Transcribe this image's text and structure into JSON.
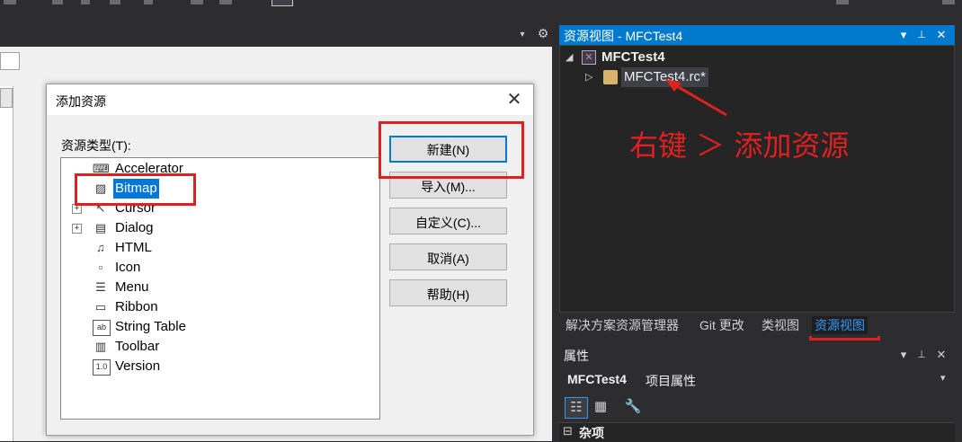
{
  "editor": {
    "dropdown_glyph": "▾",
    "gear_glyph": "⚙"
  },
  "dialog": {
    "title": "添加资源",
    "close_glyph": "✕",
    "resource_type_label": "资源类型(T):",
    "resource_types": [
      {
        "label": "Accelerator",
        "icon": "accelerator-icon",
        "glyph": "⌨",
        "expandable": false,
        "selected": false
      },
      {
        "label": "Bitmap",
        "icon": "bitmap-icon",
        "glyph": "▨",
        "expandable": false,
        "selected": true
      },
      {
        "label": "Cursor",
        "icon": "cursor-icon",
        "glyph": "↖",
        "expandable": true,
        "selected": false
      },
      {
        "label": "Dialog",
        "icon": "dialog-icon",
        "glyph": "▤",
        "expandable": true,
        "selected": false
      },
      {
        "label": "HTML",
        "icon": "html-icon",
        "glyph": "♫",
        "expandable": false,
        "selected": false
      },
      {
        "label": "Icon",
        "icon": "icon-resource-icon",
        "glyph": "▫",
        "expandable": false,
        "selected": false
      },
      {
        "label": "Menu",
        "icon": "menu-icon",
        "glyph": "☰",
        "expandable": false,
        "selected": false
      },
      {
        "label": "Ribbon",
        "icon": "ribbon-icon",
        "glyph": "▭",
        "expandable": false,
        "selected": false
      },
      {
        "label": "String Table",
        "icon": "string-table-icon",
        "glyph": "ab",
        "expandable": false,
        "selected": false
      },
      {
        "label": "Toolbar",
        "icon": "toolbar-icon",
        "glyph": "▥",
        "expandable": false,
        "selected": false
      },
      {
        "label": "Version",
        "icon": "version-icon",
        "glyph": "1.0",
        "expandable": false,
        "selected": false
      }
    ],
    "expander_glyph": "+",
    "buttons": {
      "new": "新建(N)",
      "import": "导入(M)...",
      "custom": "自定义(C)...",
      "cancel": "取消(A)",
      "help": "帮助(H)"
    }
  },
  "resource_view": {
    "title": "资源视图 - MFCTest4",
    "title_dropdown": "▾",
    "title_pin": "📌",
    "title_close": "✕",
    "project_name": "MFCTest4",
    "rc_file": "MFCTest4.rc*",
    "project_arrow": "◢",
    "rc_arrow": "▷"
  },
  "annotation": {
    "text": "右键 ＞ 添加资源",
    "color": "#e02020"
  },
  "tabs": [
    {
      "label": "解决方案资源管理器",
      "active": false
    },
    {
      "label": "Git 更改",
      "active": false
    },
    {
      "label": "类视图",
      "active": false
    },
    {
      "label": "资源视图",
      "active": true
    }
  ],
  "properties": {
    "title": "属性",
    "object_name": "MFCTest4",
    "object_type": "项目属性",
    "object_dropdown": "▾",
    "category_label": "杂项",
    "category_glyph": "⊟"
  },
  "colors": {
    "accent": "#007acc",
    "selection": "#0078d7",
    "active_tab_text": "#3399ff",
    "background": "#2d2d30"
  }
}
